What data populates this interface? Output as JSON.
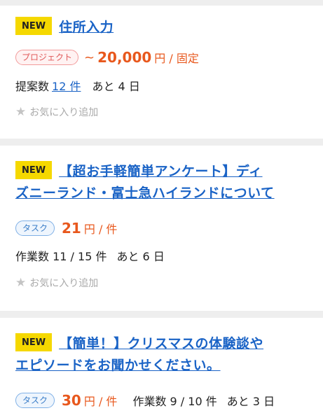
{
  "listings": [
    {
      "badge": "NEW",
      "title": "住所入力",
      "type_label": "プロジェクト",
      "price_prefix": "~",
      "price": "20,000",
      "price_unit": "円 / 固定",
      "count_label": "提案数",
      "count_value": "12 件",
      "remaining": "あと 4 日",
      "favorite_label": "お気に入り追加"
    },
    {
      "badge": "NEW",
      "title_line1": "【超お手軽簡単アンケート】ディ",
      "title_line2": "ズニーランド・富士急ハイランドについて",
      "type_label": "タスク",
      "price": "21",
      "price_unit": "円 / 件",
      "count_text": "作業数 11 / 15 件",
      "remaining": "あと 6 日",
      "favorite_label": "お気に入り追加"
    },
    {
      "badge": "NEW",
      "title_line1": "【簡単！】クリスマスの体験談や",
      "title_line2": "エピソードをお聞かせください。",
      "type_label": "タスク",
      "price": "30",
      "price_unit": "円 / 件",
      "count_text": "作業数 9 / 10 件",
      "remaining": "あと 3 日"
    }
  ],
  "colors": {
    "badge_bg": "#f5d800",
    "link": "#1a63c6",
    "price": "#e8581d",
    "separator": "#eeeeee"
  },
  "icons": {
    "favorite": "star-icon"
  }
}
